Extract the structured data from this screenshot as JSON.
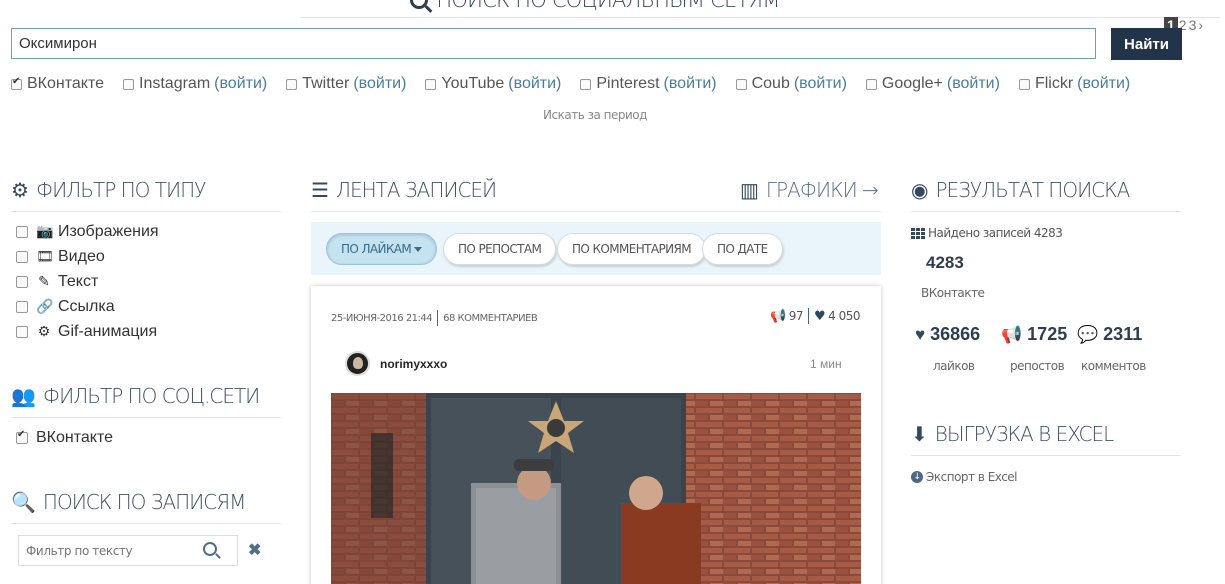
{
  "header": {
    "title": "ПОИСК ПО СОЦИАЛЬНЫМ СЕТЯМ",
    "pager": [
      "1",
      "2",
      "3",
      "›"
    ]
  },
  "search": {
    "query": "Оксимирон",
    "button_label": "Найти"
  },
  "networks": [
    {
      "name": "ВКонтакте",
      "login": "",
      "checked": true
    },
    {
      "name": "Instagram",
      "login": "(войти)",
      "checked": false
    },
    {
      "name": "Twitter",
      "login": "(войти)",
      "checked": false
    },
    {
      "name": "YouTube",
      "login": "(войти)",
      "checked": false
    },
    {
      "name": "Pinterest",
      "login": "(войти)",
      "checked": false
    },
    {
      "name": "Coub",
      "login": "(войти)",
      "checked": false
    },
    {
      "name": "Google+",
      "login": "(войти)",
      "checked": false
    },
    {
      "name": "Flickr",
      "login": "(войти)",
      "checked": false
    }
  ],
  "period_link": "Искать за период",
  "type_filter": {
    "title": "ФИЛЬТР ПО ТИПУ",
    "items": [
      {
        "label": "Изображения",
        "icon": "camera-icon"
      },
      {
        "label": "Видео",
        "icon": "film-icon"
      },
      {
        "label": "Текст",
        "icon": "edit-icon"
      },
      {
        "label": "Ссылка",
        "icon": "link-icon"
      },
      {
        "label": "Gif-анимация",
        "icon": "gear-icon"
      }
    ]
  },
  "social_filter": {
    "title": "ФИЛЬТР ПО СОЦ.СЕТИ",
    "items": [
      {
        "label": "ВКонтакте",
        "checked": true
      }
    ]
  },
  "post_search": {
    "title": "ПОИСК ПО ЗАПИСЯМ",
    "placeholder": "Фильтр по тексту"
  },
  "feed": {
    "title": "ЛЕНТА ЗАПИСЕЙ",
    "charts_link": "ГРАФИКИ →",
    "sort_buttons": [
      {
        "label": "ПО ЛАЙКАМ",
        "active": true
      },
      {
        "label": "ПО РЕПОСТАМ",
        "active": false
      },
      {
        "label": "ПО КОММЕНТАРИЯМ",
        "active": false
      },
      {
        "label": "ПО ДАТЕ",
        "active": false
      }
    ],
    "post": {
      "date": "25-ИЮНЯ-2016 21:44",
      "comments": "68 КОММЕНТАРИЕВ",
      "reposts": "97",
      "likes": "4 050",
      "author": "norimyxxxo",
      "ago": "1 мин"
    }
  },
  "results": {
    "title": "РЕЗУЛЬТАТ ПОИСКА",
    "found_label": "Найдено записей 4283",
    "count": "4283",
    "network": "ВКонтакте",
    "likes": "36866",
    "reposts": "1725",
    "comments": "2311",
    "likes_label": "лайков",
    "reposts_label": "репостов",
    "comments_label": "комментов"
  },
  "excel": {
    "title": "ВЫГРУЗКА В EXCEL",
    "link": "Экспорт в Excel"
  },
  "colors": {
    "accent": "#22344a",
    "link": "#4a7d9a",
    "sort_bar": "#eaf5fb"
  }
}
